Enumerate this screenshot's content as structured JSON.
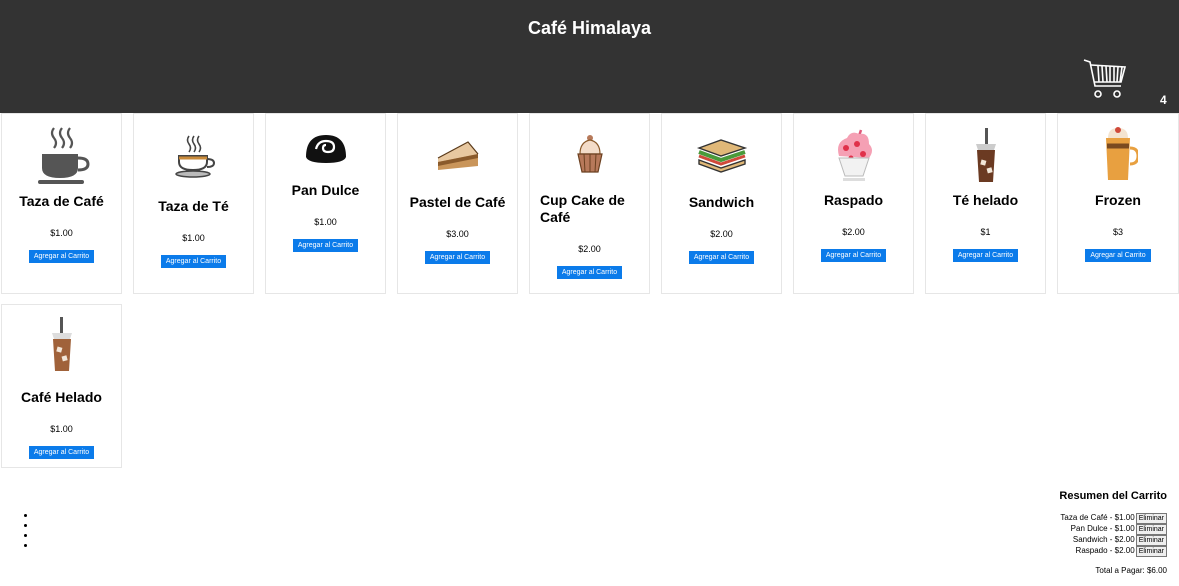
{
  "header": {
    "title": "Café Himalaya",
    "cart_count": "4"
  },
  "products": [
    {
      "name": "Taza de Café",
      "price": "$1.00",
      "button": "Agregar al Carrito",
      "icon": "coffee-cup-icon"
    },
    {
      "name": "Taza de Té",
      "price": "$1.00",
      "button": "Agregar al Carrito",
      "icon": "tea-cup-icon"
    },
    {
      "name": "Pan Dulce",
      "price": "$1.00",
      "button": "Agregar al Carrito",
      "icon": "sweet-bread-icon"
    },
    {
      "name": "Pastel de Café",
      "price": "$3.00",
      "button": "Agregar al Carrito",
      "icon": "cake-slice-icon"
    },
    {
      "name": "Cup Cake de Café",
      "price": "$2.00",
      "button": "Agregar al Carrito",
      "icon": "cupcake-icon"
    },
    {
      "name": "Sandwich",
      "price": "$2.00",
      "button": "Agregar al Carrito",
      "icon": "sandwich-icon"
    },
    {
      "name": "Raspado",
      "price": "$2.00",
      "button": "Agregar al Carrito",
      "icon": "shaved-ice-icon"
    },
    {
      "name": "Té helado",
      "price": "$1",
      "button": "Agregar al Carrito",
      "icon": "iced-tea-icon"
    },
    {
      "name": "Frozen",
      "price": "$3",
      "button": "Agregar al Carrito",
      "icon": "frozen-drink-icon"
    },
    {
      "name": "Café Helado",
      "price": "$1.00",
      "button": "Agregar al Carrito",
      "icon": "iced-coffee-icon"
    }
  ],
  "summary": {
    "title": "Resumen del Carrito",
    "items": [
      {
        "text": "Taza de Café - $1.00",
        "remove": "Eliminar"
      },
      {
        "text": "Pan Dulce - $1.00",
        "remove": "Eliminar"
      },
      {
        "text": "Sandwich - $2.00",
        "remove": "Eliminar"
      },
      {
        "text": "Raspado - $2.00",
        "remove": "Eliminar"
      }
    ],
    "total": "Total a Pagar: $6.00"
  }
}
